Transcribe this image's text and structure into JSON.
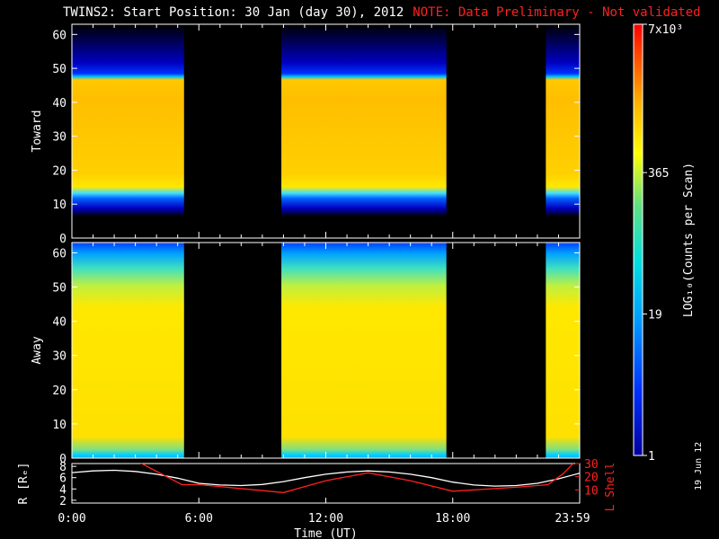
{
  "header": {
    "title": "TWINS2: Start Position: 30 Jan (day  30), 2012",
    "note": "NOTE: Data Preliminary - Not validated"
  },
  "timestamp": "19 Jun 12",
  "colors": {
    "frame": "#ffffff",
    "note": "#ff2020",
    "r_line": "#ffffff",
    "l_line": "#ff2020"
  },
  "chart_data": [
    {
      "type": "heatmap",
      "name": "Toward",
      "ylabel": "Toward",
      "ylim": [
        0,
        63
      ],
      "yticks": [
        0,
        10,
        20,
        30,
        40,
        50,
        60
      ],
      "x_unit": "hours UT",
      "data_intervals_hours": [
        [
          0,
          5.3
        ],
        [
          9.9,
          17.7
        ],
        [
          22.4,
          24
        ]
      ],
      "high_count_band": [
        13,
        48
      ],
      "sparse_band": [
        48,
        62
      ]
    },
    {
      "type": "heatmap",
      "name": "Away",
      "ylabel": "Away",
      "ylim": [
        0,
        63
      ],
      "yticks": [
        0,
        10,
        20,
        30,
        40,
        50,
        60
      ],
      "data_intervals_hours": [
        [
          0,
          5.3
        ],
        [
          9.9,
          17.7
        ],
        [
          22.4,
          24
        ]
      ],
      "high_count_band": [
        2,
        55
      ],
      "sparse_band": [
        55,
        63
      ]
    },
    {
      "type": "line",
      "xlim": [
        0,
        24
      ],
      "xticks": [
        "0:00",
        "6:00",
        "12:00",
        "18:00",
        "23:59"
      ],
      "xlabel": "Time (UT)",
      "ylabel_left": "R [Rₑ]",
      "ylabel_right": "L Shell",
      "ylim_left": [
        1.5,
        8.5
      ],
      "ylim_right": [
        0,
        30
      ],
      "yticks_left": [
        2,
        4,
        6,
        8
      ],
      "yticks_right": [
        10,
        20,
        30
      ],
      "series": [
        {
          "name": "R [Rₑ]",
          "axis": "left",
          "x": [
            0,
            1,
            2,
            3,
            4,
            5,
            6,
            7,
            8,
            9,
            10,
            11,
            12,
            13,
            14,
            15,
            16,
            17,
            18,
            19,
            20,
            21,
            22,
            23,
            24
          ],
          "values": [
            6.9,
            7.2,
            7.3,
            7.1,
            6.6,
            5.9,
            5.0,
            4.7,
            4.6,
            4.8,
            5.3,
            6.0,
            6.6,
            7.0,
            7.2,
            7.0,
            6.6,
            6.0,
            5.2,
            4.7,
            4.5,
            4.6,
            5.0,
            5.8,
            6.8
          ]
        },
        {
          "name": "L Shell",
          "axis": "right",
          "x": [
            0,
            2.7,
            5.2,
            6,
            10,
            12,
            14,
            16,
            18,
            21,
            22.5,
            23.2,
            24
          ],
          "values": [
            null,
            35,
            14,
            14,
            8,
            17,
            23,
            17,
            9,
            12,
            14,
            22,
            35
          ]
        }
      ]
    }
  ],
  "colorbar": {
    "label": "LOG₁₀(Counts per Scan)",
    "ticks": [
      "1",
      "19",
      "365",
      "7x10³"
    ]
  }
}
